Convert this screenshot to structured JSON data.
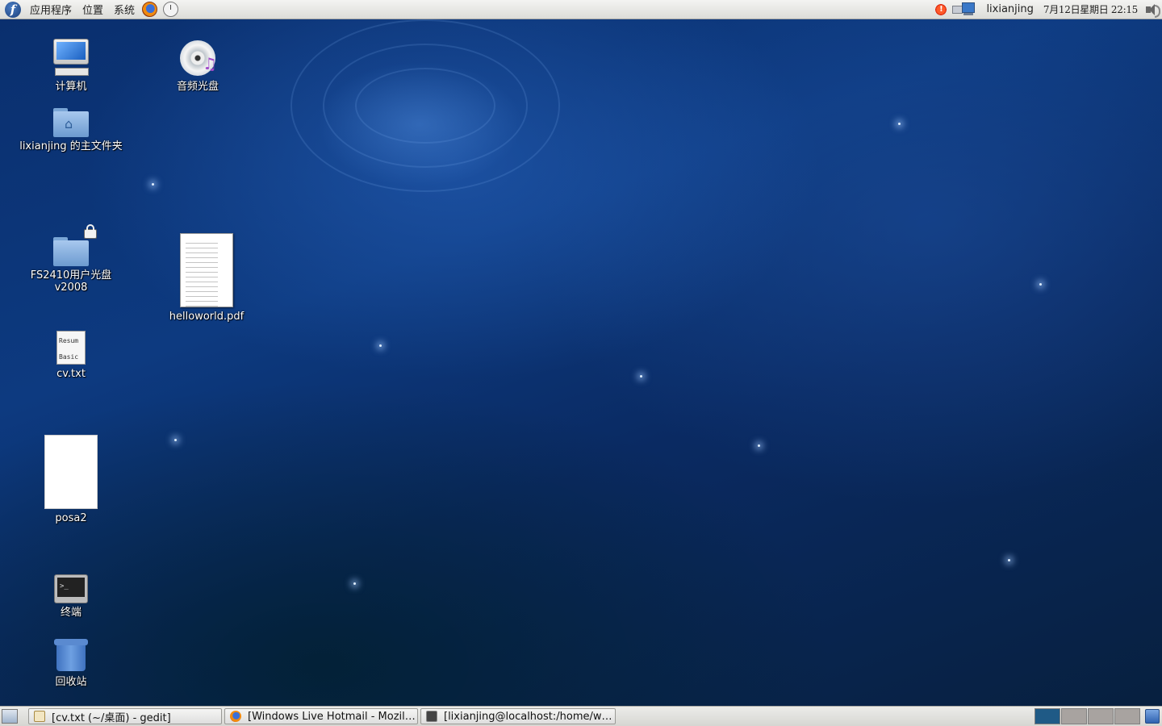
{
  "top_panel": {
    "menus": {
      "applications": "应用程序",
      "places": "位置",
      "system": "系统"
    },
    "user": "lixianjing",
    "datetime": "7月12日星期日 22:15",
    "update_badge": "!",
    "icons": [
      "fedora-logo-icon",
      "firefox-icon",
      "clock-mail-icon",
      "update-notifier-icon",
      "network-icon",
      "volume-icon"
    ]
  },
  "desktop": {
    "icons": [
      {
        "label": "计算机",
        "icon": "computer-icon"
      },
      {
        "label": "lixianjing 的主文件夹",
        "icon": "home-folder-icon"
      },
      {
        "label": "FS2410用户光盘\nv2008",
        "label_line1": "FS2410用户光盘",
        "label_line2": "v2008",
        "icon": "locked-folder-icon"
      },
      {
        "label": "cv.txt",
        "icon": "text-file-icon",
        "preview": [
          "Resum",
          "Basic"
        ]
      },
      {
        "label": "posa2",
        "icon": "blank-document-icon"
      },
      {
        "label": "终端",
        "icon": "terminal-icon",
        "preview": ">_"
      },
      {
        "label": "回收站",
        "icon": "trash-icon"
      },
      {
        "label": "音频光盘",
        "icon": "audio-cd-icon"
      },
      {
        "label": "helloworld.pdf",
        "icon": "pdf-file-icon"
      }
    ]
  },
  "bottom_panel": {
    "tasks": [
      {
        "label": "[cv.txt (~/桌面) - gedit]",
        "icon": "gedit-icon"
      },
      {
        "label": "[Windows Live Hotmail - Mozill…",
        "icon": "firefox-icon"
      },
      {
        "label": "[lixianjing@localhost:/home/w…",
        "icon": "terminal-icon"
      }
    ],
    "workspaces": {
      "count": 4,
      "active_index": 0
    }
  },
  "colors": {
    "panel_bg": "#e4e4e0",
    "desktop_base": "#0b2d63",
    "active_workspace": "#1f5a86",
    "inactive_workspace": "#a8a3a0"
  }
}
